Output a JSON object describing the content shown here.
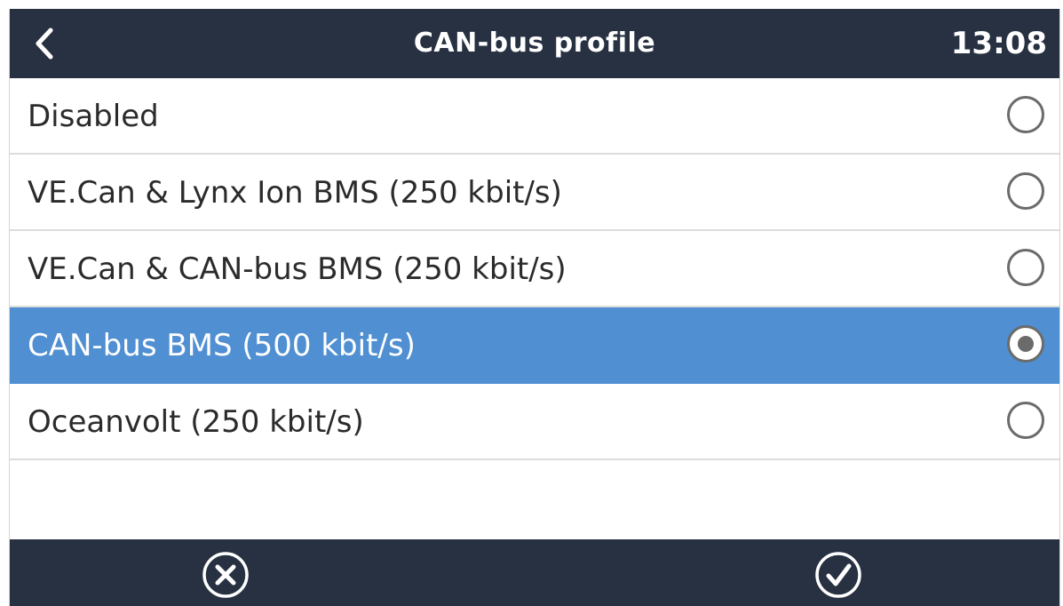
{
  "header": {
    "title": "CAN-bus profile",
    "time": "13:08",
    "back_icon": "chevron-left-icon"
  },
  "options": [
    {
      "label": "Disabled",
      "selected": false
    },
    {
      "label": "VE.Can & Lynx Ion BMS (250 kbit/s)",
      "selected": false
    },
    {
      "label": "VE.Can & CAN-bus BMS (250 kbit/s)",
      "selected": false
    },
    {
      "label": "CAN-bus BMS (500 kbit/s)",
      "selected": true
    },
    {
      "label": "Oceanvolt (250 kbit/s)",
      "selected": false
    }
  ],
  "footer": {
    "cancel_icon": "cancel-circle-icon",
    "confirm_icon": "check-circle-icon"
  },
  "colors": {
    "header_bg": "#273142",
    "selected_bg": "#4f8fd2",
    "text": "#2b2b2b"
  }
}
